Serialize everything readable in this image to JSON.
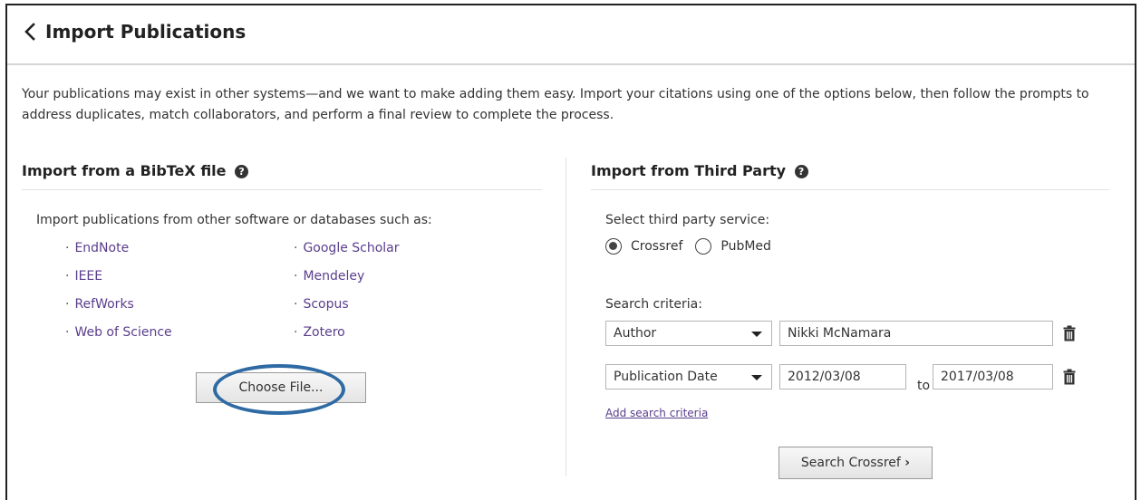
{
  "header": {
    "title": "Import Publications",
    "back_icon": "chevron-left-icon"
  },
  "intro_text": "Your publications may exist in other systems—and we want to make adding them easy. Import your citations using one of the options below, then follow the prompts to address duplicates, match collaborators, and perform a final review to complete the process.",
  "bibtex": {
    "title": "Import from a BibTeX file",
    "help_icon": "question-circle-icon",
    "help_glyph": "?",
    "description": "Import publications from other software or databases such as:",
    "bullet": "·",
    "sources_left": [
      "EndNote",
      "IEEE",
      "RefWorks",
      "Web of Science"
    ],
    "sources_right": [
      "Google Scholar",
      "Mendeley",
      "Scopus",
      "Zotero"
    ],
    "choose_file_label": "Choose File..."
  },
  "third_party": {
    "title": "Import from Third Party",
    "help_icon": "question-circle-icon",
    "help_glyph": "?",
    "service_label": "Select third party service:",
    "services": [
      {
        "label": "Crossref",
        "selected": true
      },
      {
        "label": "PubMed",
        "selected": false
      }
    ],
    "criteria_label": "Search criteria:",
    "criteria": [
      {
        "field": "Author",
        "value": "Nikki McNamara"
      },
      {
        "field": "Publication Date",
        "from": "2012/03/08",
        "to_label": "to",
        "to": "2017/03/08"
      }
    ],
    "add_criteria_label": "Add search criteria",
    "search_button_label": "Search Crossref",
    "search_button_icon": "chevron-right-icon",
    "search_button_glyph": "›"
  },
  "colors": {
    "link": "#5a3e8c",
    "highlight_ring": "#2e6aa3",
    "border": "#222222"
  }
}
